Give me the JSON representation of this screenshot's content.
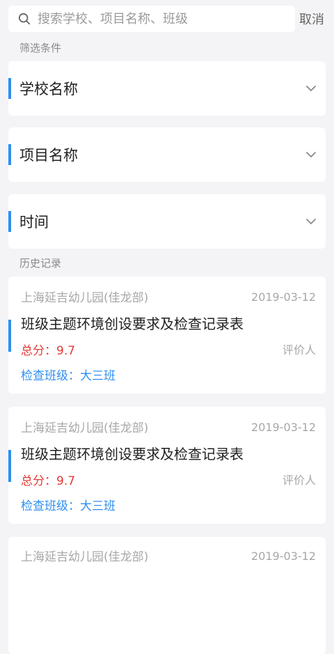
{
  "search": {
    "placeholder": "搜索学校、项目名称、班级",
    "cancel_label": "取消"
  },
  "filters": {
    "section_label": "筛选条件",
    "items": [
      {
        "label": "学校名称"
      },
      {
        "label": "项目名称"
      },
      {
        "label": "时间"
      }
    ]
  },
  "history": {
    "section_label": "历史记录",
    "records": [
      {
        "school": "上海延吉幼儿园(佳龙部)",
        "date": "2019-03-12",
        "title": "班级主题环境创设要求及检查记录表",
        "score": "总分：9.7",
        "evaluator": "评价人",
        "class": "检查班级：大三班"
      },
      {
        "school": "上海延吉幼儿园(佳龙部)",
        "date": "2019-03-12",
        "title": "班级主题环境创设要求及检查记录表",
        "score": "总分：9.7",
        "evaluator": "评价人",
        "class": "检查班级：大三班"
      },
      {
        "school": "上海延吉幼儿园(佳龙部)",
        "date": "2019-03-12"
      }
    ]
  },
  "colors": {
    "accent": "#2f8ff0",
    "score": "#e53935",
    "background": "#f4f4f6"
  },
  "icons": {
    "search": "search-icon",
    "dropdown": "chevron-down-icon"
  }
}
